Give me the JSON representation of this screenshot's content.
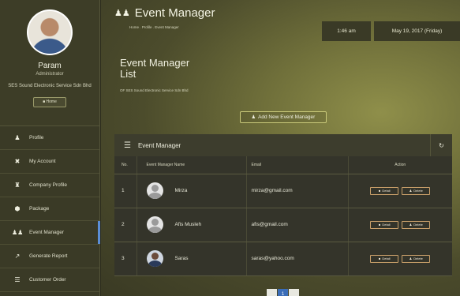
{
  "profile": {
    "name": "Param",
    "role": "Administrator",
    "company": "SES Sound Electronic Service Sdn Bhd",
    "home_label": "Home"
  },
  "nav": [
    {
      "label": "Profile",
      "icon": "user-icon"
    },
    {
      "label": "My Account",
      "icon": "tools-icon"
    },
    {
      "label": "Company Profile",
      "icon": "building-icon"
    },
    {
      "label": "Package",
      "icon": "package-icon"
    },
    {
      "label": "Event Manager",
      "icon": "users-icon",
      "active": true
    },
    {
      "label": "Generate Report",
      "icon": "chart-icon"
    },
    {
      "label": "Customer Order",
      "icon": "list-icon"
    }
  ],
  "header": {
    "title": "Event Manager",
    "breadcrumb": "Home . Profile . Event Manager",
    "time": "1:46 am",
    "date": "May 19, 2017 (Friday)"
  },
  "list": {
    "title": "Event Manager List",
    "company": "OF SES Sound Electronic Service Sdn Bhd",
    "add_button": "Add New Event Manager"
  },
  "panel": {
    "title": "Event Manager",
    "columns": [
      "No.",
      "Event Manager Name",
      "Email",
      "Action"
    ],
    "rows": [
      {
        "no": "1",
        "name": "Mirza",
        "email": "mirza@gmail.com",
        "photo": false
      },
      {
        "no": "2",
        "name": "Afis Musleh",
        "email": "afis@gmail.com",
        "photo": false
      },
      {
        "no": "3",
        "name": "Saras",
        "email": "saras@yahoo.com",
        "photo": true
      }
    ],
    "detail_label": "Detail",
    "delete_label": "Delete"
  },
  "pagination": {
    "pages": [
      "",
      "1",
      ""
    ],
    "current": "1"
  }
}
